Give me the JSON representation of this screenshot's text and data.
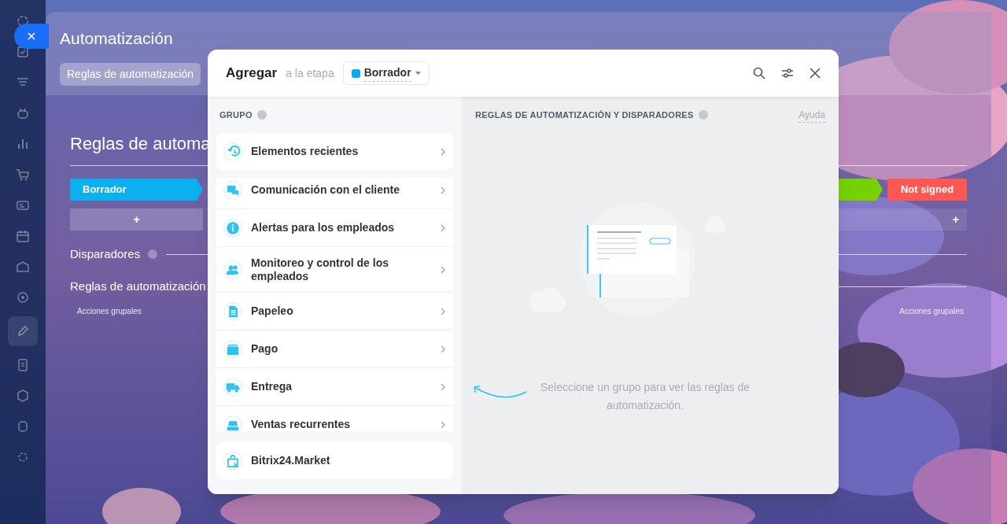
{
  "sidebar": {
    "items": [
      {
        "selected": false
      },
      {
        "selected": false
      },
      {
        "selected": false
      },
      {
        "selected": false
      },
      {
        "selected": false
      },
      {
        "selected": false
      },
      {
        "selected": false
      },
      {
        "selected": false
      },
      {
        "selected": false
      },
      {
        "selected": false
      },
      {
        "selected": true
      },
      {
        "selected": false
      },
      {
        "selected": false
      },
      {
        "selected": false
      },
      {
        "selected": false
      }
    ]
  },
  "slider": {
    "title": "Automatización",
    "tabs": [
      {
        "label": "Reglas de automatización",
        "selected": true
      }
    ]
  },
  "background_page": {
    "heading": "Reglas de automa",
    "stages_left": [
      {
        "label": "Borrador",
        "color": "#0bb0f0"
      }
    ],
    "stages_right": [
      {
        "color": "#77d000"
      },
      {
        "label": "Not signed",
        "color": "#ff5752"
      }
    ],
    "add_buttons": [
      "+",
      "+"
    ],
    "triggers_label": "Disparadores",
    "rules_label": "Reglas de automatización",
    "group_actions": [
      "Acciones grupales",
      "Acciones grupales"
    ]
  },
  "modal": {
    "title": "Agregar",
    "subtitle": "a la etapa",
    "stage": {
      "label": "Borrador",
      "color": "#0aa8f0"
    },
    "group_heading": "GRUPO",
    "recent": {
      "label": "Elementos recientes"
    },
    "groups": [
      {
        "label": "Comunicación con el cliente"
      },
      {
        "label": "Alertas para los empleados"
      },
      {
        "label": "Monitoreo y control de los empleados"
      },
      {
        "label": "Papeleo"
      },
      {
        "label": "Pago"
      },
      {
        "label": "Entrega"
      },
      {
        "label": "Ventas recurrentes"
      }
    ],
    "market": {
      "label": "Bitrix24.Market"
    },
    "rules_heading": "REGLAS DE AUTOMATIZACIÓN Y DISPARADORES",
    "help_link": "Ayuda",
    "empty_message": "Seleccione un grupo para ver las reglas de automatización."
  }
}
